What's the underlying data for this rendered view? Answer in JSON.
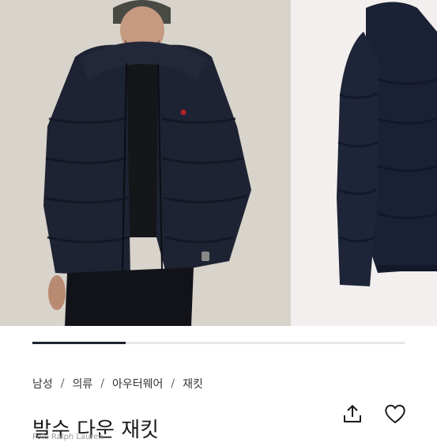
{
  "breadcrumb": {
    "items": [
      "남성",
      "의류",
      "아우터웨어",
      "재킷"
    ],
    "separator": "/"
  },
  "product": {
    "title": "발수 다운 재킷",
    "subtext": "Polo Ralph Lauren"
  },
  "carousel": {
    "progress": 0.25,
    "accent_color": "#1f2430"
  },
  "icons": {
    "share": "share-icon",
    "wishlist": "heart-icon"
  }
}
